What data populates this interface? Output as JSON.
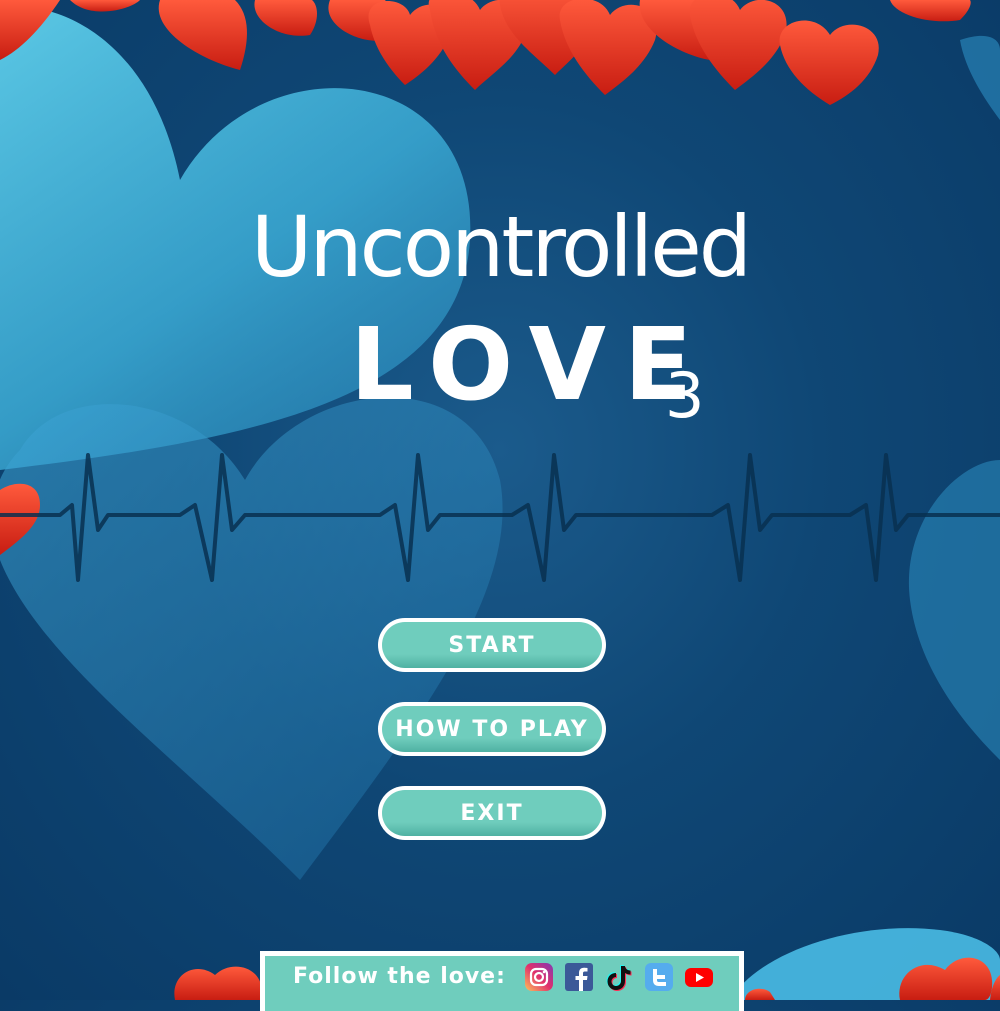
{
  "title": {
    "line1": "Uncontrolled",
    "line2": "LOVE",
    "number": "3"
  },
  "menu": {
    "start_label": "START",
    "how_to_play_label": "HOW TO PLAY",
    "exit_label": "EXIT"
  },
  "footer": {
    "follow_label": "Follow the love:",
    "social_icons": [
      "instagram-icon",
      "facebook-icon",
      "tiktok-icon",
      "twitter-icon",
      "youtube-icon"
    ]
  },
  "colors": {
    "background": "#0f4775",
    "heart_light": "#5fd6f2",
    "heart_red": "#e8321e",
    "button_teal": "#6fcdbd",
    "button_border": "#ffffff",
    "heartbeat_line": "#083050"
  }
}
